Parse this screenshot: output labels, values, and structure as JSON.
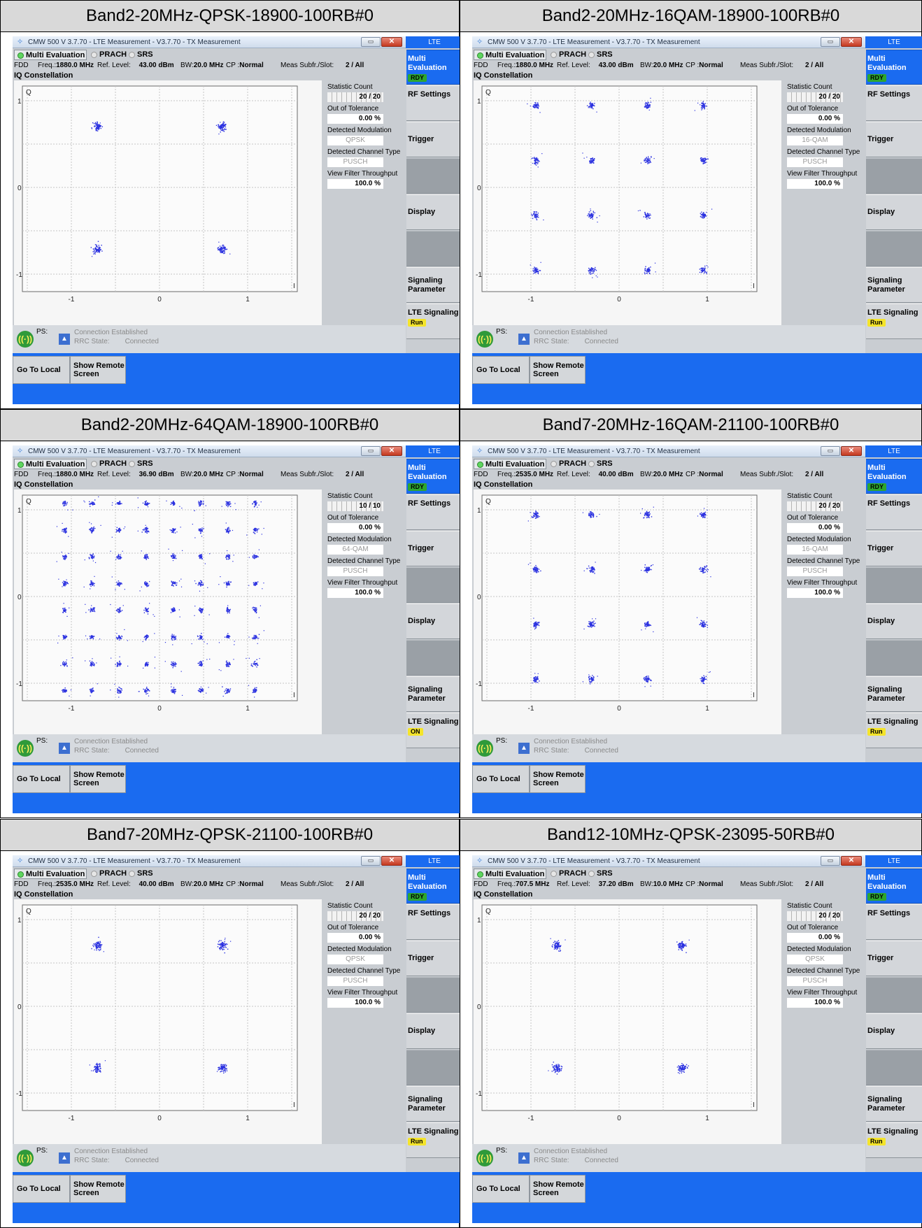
{
  "colors": {
    "accent_blue": "#1a6bf0",
    "constellation_blue": "#2a30e0",
    "ready_green": "#2ea62e",
    "run_yellow": "#f4e42a"
  },
  "common": {
    "window_title": "CMW 500 V 3.7.70 - LTE Measurement  - V3.7.70 - TX Measurement",
    "tabs": [
      "Multi Evaluation",
      "PRACH",
      "SRS"
    ],
    "duplex": "FDD",
    "freq_label": "Freq.:",
    "ref_label": "Ref. Level:",
    "bw_label": "BW:",
    "cp_label": "CP :",
    "cp_value": "Normal",
    "meas_label": "Meas Subfr./Slot:",
    "meas_value": "2  / All",
    "section_title": "IQ Constellation",
    "q_axis": "Q",
    "i_axis": "I",
    "y_ticks": [
      "1",
      "0",
      "-1"
    ],
    "x_ticks": [
      "-1",
      "0",
      "1"
    ],
    "stat_labels": {
      "count": "Statistic Count",
      "tolerance": "Out of Tolerance",
      "modulation": "Detected Modulation",
      "channel": "Detected Channel Type",
      "throughput": "View Filter Throughput"
    },
    "tolerance_value": "0.00  %",
    "channel_value": "PUSCH",
    "throughput_value": "100.0  %",
    "ps_label": "PS:",
    "connection_text": "Connection Established",
    "rrc_label": "RRC State:",
    "rrc_value": "Connected",
    "go_local": "Go To Local",
    "show_remote": "Show Remote Screen",
    "sidebar_head": "LTE",
    "sidebar": {
      "multi_eval": "Multi Evaluation",
      "rdy": "RDY",
      "rf": "RF Settings",
      "trigger": "Trigger",
      "display": "Display",
      "signaling_param": "Signaling Parameter",
      "lte_signaling": "LTE Signaling"
    }
  },
  "panels": [
    {
      "title": "Band2-20MHz-QPSK-18900-100RB#0",
      "freq": "1880.0 MHz",
      "ref": "43.00 dBm",
      "bw": "20.0 MHz",
      "stat_count": "20 / 20",
      "modulation": "QPSK",
      "signal_state": "Run",
      "constellation_order": 4
    },
    {
      "title": "Band2-20MHz-16QAM-18900-100RB#0",
      "freq": "1880.0 MHz",
      "ref": "43.00 dBm",
      "bw": "20.0 MHz",
      "stat_count": "20 / 20",
      "modulation": "16-QAM",
      "signal_state": "Run",
      "constellation_order": 16
    },
    {
      "title": "Band2-20MHz-64QAM-18900-100RB#0",
      "freq": "1880.0 MHz",
      "ref": "36.90 dBm",
      "bw": "20.0 MHz",
      "stat_count": "10 / 10",
      "modulation": "64-QAM",
      "signal_state": "ON",
      "constellation_order": 64
    },
    {
      "title": "Band7-20MHz-16QAM-21100-100RB#0",
      "freq": "2535.0 MHz",
      "ref": "40.00 dBm",
      "bw": "20.0 MHz",
      "stat_count": "20 / 20",
      "modulation": "16-QAM",
      "signal_state": "Run",
      "constellation_order": 16
    },
    {
      "title": "Band7-20MHz-QPSK-21100-100RB#0",
      "freq": "2535.0 MHz",
      "ref": "40.00 dBm",
      "bw": "20.0 MHz",
      "stat_count": "20 / 20",
      "modulation": "QPSK",
      "signal_state": "Run",
      "constellation_order": 4
    },
    {
      "title": "Band12-10MHz-QPSK-23095-50RB#0",
      "freq": "707.5 MHz",
      "ref": "37.20 dBm",
      "bw": "10.0 MHz",
      "stat_count": "20 / 20",
      "modulation": "QPSK",
      "signal_state": "Run",
      "constellation_order": 4
    }
  ]
}
